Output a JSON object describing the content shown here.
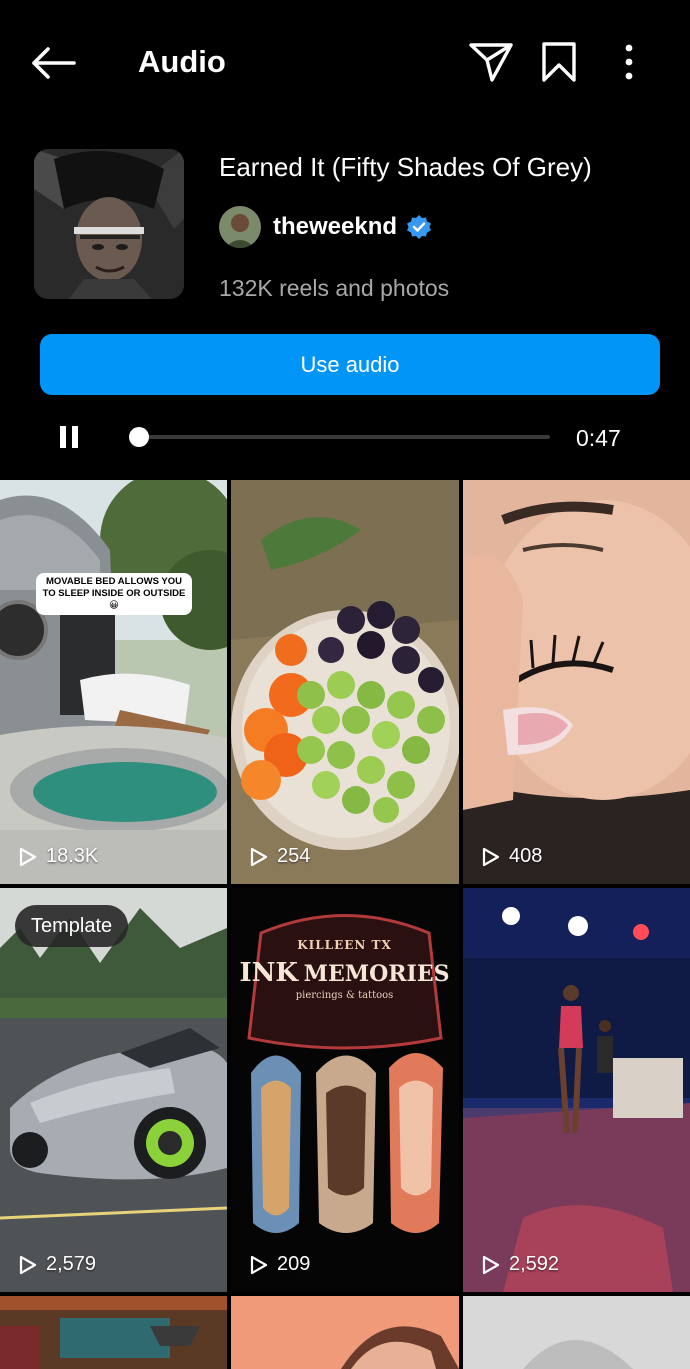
{
  "header": {
    "title": "Audio",
    "back_icon": "arrow-left-icon",
    "send_icon": "paper-plane-icon",
    "save_icon": "bookmark-icon",
    "more_icon": "vertical-dots-icon"
  },
  "track": {
    "title": "Earned It (Fifty Shades Of Grey)",
    "artist": "theweeknd",
    "verified": true,
    "reels_count": "132K reels and photos"
  },
  "actions": {
    "use_audio_label": "Use audio"
  },
  "player": {
    "state": "playing",
    "control_icon": "pause-icon",
    "progress_fraction": 0,
    "time": "0:47"
  },
  "grid": [
    {
      "kind": "reel",
      "plays": "18.3K",
      "caption": "MOVABLE BED ALLOWS YOU TO SLEEP INSIDE OR OUTSIDE 😀"
    },
    {
      "kind": "reel",
      "plays": "254"
    },
    {
      "kind": "reel",
      "plays": "408"
    },
    {
      "kind": "template",
      "badge": "Template",
      "plays": "2,579"
    },
    {
      "kind": "reel",
      "plays": "209",
      "sign_lines": [
        "KILLEEN TX",
        "INK",
        "MEMORIES",
        "piercings",
        "& tattoos"
      ]
    },
    {
      "kind": "reel",
      "plays": "2,592"
    }
  ],
  "colors": {
    "background": "#000000",
    "accent": "#0095f6",
    "secondary_text": "#a8a8a8",
    "verified": "#3897f0"
  }
}
